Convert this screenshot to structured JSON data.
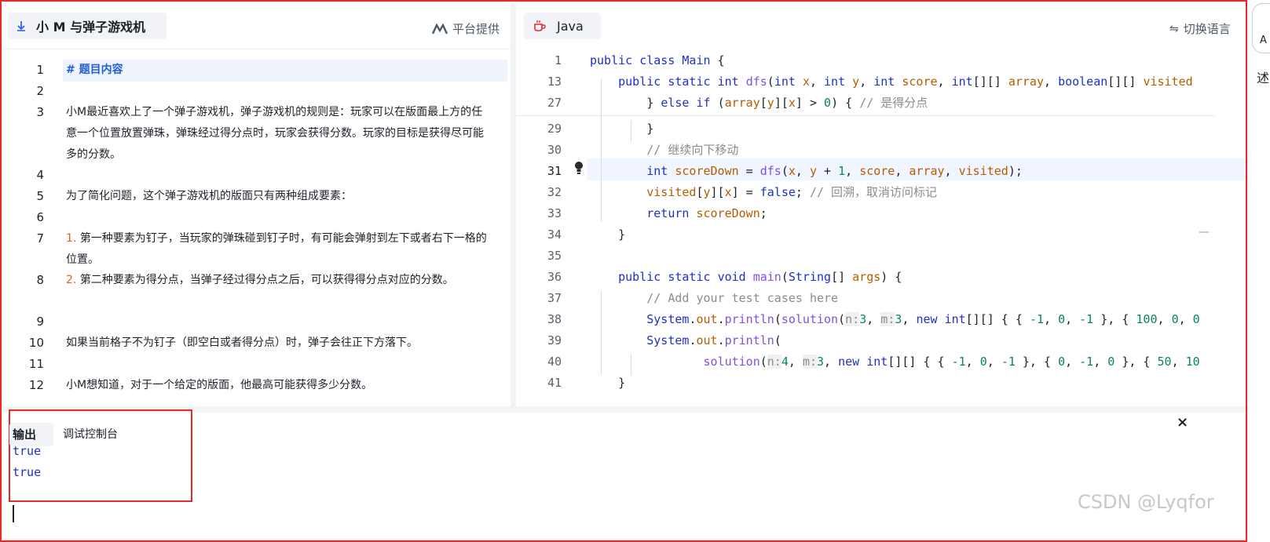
{
  "left": {
    "problem_title": "小 M 与弹子游戏机",
    "provider_label": "平台提供",
    "lines": [
      {
        "n": "1",
        "parts": [
          {
            "t": "# 题目内容",
            "c": "heading"
          }
        ]
      },
      {
        "n": "2",
        "parts": []
      },
      {
        "n": "3",
        "parts": [
          {
            "t": "小M最近喜欢上了一个弹子游戏机，弹子游戏机的规则是：玩家可以在版面最上方的任意一个位置放置弹珠，弹珠经过得分点时，玩家会获得分数。玩家的目标是获得尽可能多的分数。",
            "c": ""
          }
        ]
      },
      {
        "n": "4",
        "parts": []
      },
      {
        "n": "5",
        "parts": [
          {
            "t": "为了简化问题，这个弹子游戏机的版面只有两种组成要素：",
            "c": ""
          }
        ]
      },
      {
        "n": "6",
        "parts": []
      },
      {
        "n": "7",
        "parts": [
          {
            "t": "1. ",
            "c": "num"
          },
          {
            "t": "第一种要素为钉子，当玩家的弹珠碰到钉子时，有可能会弹射到左下或者右下一格的位置。",
            "c": ""
          }
        ]
      },
      {
        "n": "8",
        "parts": [
          {
            "t": "2. ",
            "c": "num"
          },
          {
            "t": "第二种要素为得分点，当弹子经过得分点之后，可以获得得分点对应的分数。",
            "c": ""
          }
        ]
      },
      {
        "n": "9",
        "parts": []
      },
      {
        "n": "10",
        "parts": [
          {
            "t": "如果当前格子不为钉子（即空白或者得分点）时，弹子会往正下方落下。",
            "c": ""
          }
        ]
      },
      {
        "n": "11",
        "parts": []
      },
      {
        "n": "12",
        "parts": [
          {
            "t": "小M想知道，对于一个给定的版面，他最高可能获得多少分数。",
            "c": ""
          }
        ]
      }
    ]
  },
  "right": {
    "language": "Java",
    "switch_label": "切换语言",
    "active_line": "31",
    "code_lines": [
      {
        "n": "1",
        "tokens": [
          [
            "public ",
            "kw"
          ],
          [
            "class ",
            "kw"
          ],
          [
            "Main",
            "cls"
          ],
          [
            " {",
            ""
          ]
        ]
      },
      {
        "n": "13",
        "tokens": [
          [
            "    public ",
            "kw"
          ],
          [
            "static ",
            "kw"
          ],
          [
            "int ",
            "ty"
          ],
          [
            "dfs",
            "fn"
          ],
          [
            "(",
            ""
          ],
          [
            "int ",
            "ty"
          ],
          [
            "x",
            "va"
          ],
          [
            ", ",
            ""
          ],
          [
            "int ",
            "ty"
          ],
          [
            "y",
            "va"
          ],
          [
            ", ",
            ""
          ],
          [
            "int ",
            "ty"
          ],
          [
            "score",
            "va"
          ],
          [
            ", ",
            ""
          ],
          [
            "int",
            "ty"
          ],
          [
            "[][] ",
            ""
          ],
          [
            "array",
            "va"
          ],
          [
            ", ",
            ""
          ],
          [
            "boolean",
            "ty"
          ],
          [
            "[][] ",
            ""
          ],
          [
            "visited",
            "va"
          ]
        ]
      },
      {
        "n": "27",
        "tokens": [
          [
            "        } ",
            ""
          ],
          [
            "else ",
            "kw"
          ],
          [
            "if ",
            "kw"
          ],
          [
            "(",
            ""
          ],
          [
            "array",
            "va"
          ],
          [
            "[",
            ""
          ],
          [
            "y",
            "va"
          ],
          [
            "][",
            ""
          ],
          [
            "x",
            "va"
          ],
          [
            "] > ",
            ""
          ],
          [
            "0",
            "num2"
          ],
          [
            ") { ",
            ""
          ],
          [
            "// 是得分点",
            "cm"
          ]
        ]
      },
      {
        "n": "29",
        "tokens": [
          [
            "        }",
            ""
          ]
        ]
      },
      {
        "n": "30",
        "tokens": [
          [
            "        ",
            ""
          ],
          [
            "// 继续向下移动",
            "cm"
          ]
        ]
      },
      {
        "n": "31",
        "tokens": [
          [
            "        ",
            ""
          ],
          [
            "int ",
            "ty"
          ],
          [
            "scoreDown",
            "va"
          ],
          [
            " = ",
            ""
          ],
          [
            "dfs",
            "fn"
          ],
          [
            "(",
            ""
          ],
          [
            "x",
            "va"
          ],
          [
            ", ",
            ""
          ],
          [
            "y",
            "va"
          ],
          [
            " + ",
            ""
          ],
          [
            "1",
            "num2"
          ],
          [
            ", ",
            ""
          ],
          [
            "score",
            "va"
          ],
          [
            ", ",
            ""
          ],
          [
            "array",
            "va"
          ],
          [
            ", ",
            ""
          ],
          [
            "visited",
            "va"
          ],
          [
            ");",
            ""
          ]
        ]
      },
      {
        "n": "32",
        "tokens": [
          [
            "        ",
            ""
          ],
          [
            "visited",
            "va"
          ],
          [
            "[",
            ""
          ],
          [
            "y",
            "va"
          ],
          [
            "][",
            ""
          ],
          [
            "x",
            "va"
          ],
          [
            "] = ",
            ""
          ],
          [
            "false",
            "kw"
          ],
          [
            "; ",
            ""
          ],
          [
            "// 回溯，取消访问标记",
            "cm"
          ]
        ]
      },
      {
        "n": "33",
        "tokens": [
          [
            "        ",
            ""
          ],
          [
            "return ",
            "kw"
          ],
          [
            "scoreDown",
            "va"
          ],
          [
            ";",
            ""
          ]
        ]
      },
      {
        "n": "34",
        "tokens": [
          [
            "    }",
            ""
          ]
        ]
      },
      {
        "n": "35",
        "tokens": []
      },
      {
        "n": "36",
        "tokens": [
          [
            "    public ",
            "kw"
          ],
          [
            "static ",
            "kw"
          ],
          [
            "void ",
            "ty"
          ],
          [
            "main",
            "fn"
          ],
          [
            "(",
            ""
          ],
          [
            "String",
            "cls"
          ],
          [
            "[] ",
            ""
          ],
          [
            "args",
            "va"
          ],
          [
            ") {",
            ""
          ]
        ]
      },
      {
        "n": "37",
        "tokens": [
          [
            "        ",
            ""
          ],
          [
            "// Add your test cases here",
            "cm"
          ]
        ]
      },
      {
        "n": "38",
        "tokens": [
          [
            "        ",
            ""
          ],
          [
            "System",
            "cls"
          ],
          [
            ".",
            ""
          ],
          [
            "out",
            "va"
          ],
          [
            ".",
            ""
          ],
          [
            "println",
            "fn"
          ],
          [
            "(",
            ""
          ],
          [
            "solution",
            "fn"
          ],
          [
            "(",
            ""
          ],
          [
            "n:",
            "hint"
          ],
          [
            "3",
            "num2"
          ],
          [
            ", ",
            ""
          ],
          [
            "m:",
            "hint"
          ],
          [
            "3",
            "num2"
          ],
          [
            ", ",
            ""
          ],
          [
            "new ",
            "kw"
          ],
          [
            "int",
            "ty"
          ],
          [
            "[][] { { ",
            ""
          ],
          [
            "-1",
            "num2"
          ],
          [
            ", ",
            ""
          ],
          [
            "0",
            "num2"
          ],
          [
            ", ",
            ""
          ],
          [
            "-1",
            "num2"
          ],
          [
            " }, { ",
            ""
          ],
          [
            "100",
            "num2"
          ],
          [
            ", ",
            ""
          ],
          [
            "0",
            "num2"
          ],
          [
            ", ",
            ""
          ],
          [
            "0",
            "num2"
          ]
        ]
      },
      {
        "n": "39",
        "tokens": [
          [
            "        ",
            ""
          ],
          [
            "System",
            "cls"
          ],
          [
            ".",
            ""
          ],
          [
            "out",
            "va"
          ],
          [
            ".",
            ""
          ],
          [
            "println",
            "fn"
          ],
          [
            "(",
            ""
          ]
        ]
      },
      {
        "n": "40",
        "tokens": [
          [
            "                ",
            ""
          ],
          [
            "solution",
            "fn"
          ],
          [
            "(",
            ""
          ],
          [
            "n:",
            "hint"
          ],
          [
            "4",
            "num2"
          ],
          [
            ", ",
            ""
          ],
          [
            "m:",
            "hint"
          ],
          [
            "3",
            "num2"
          ],
          [
            ", ",
            ""
          ],
          [
            "new ",
            "kw"
          ],
          [
            "int",
            "ty"
          ],
          [
            "[][] { { ",
            ""
          ],
          [
            "-1",
            "num2"
          ],
          [
            ", ",
            ""
          ],
          [
            "0",
            "num2"
          ],
          [
            ", ",
            ""
          ],
          [
            "-1",
            "num2"
          ],
          [
            " }, { ",
            ""
          ],
          [
            "0",
            "num2"
          ],
          [
            ", ",
            ""
          ],
          [
            "-1",
            "num2"
          ],
          [
            ", ",
            ""
          ],
          [
            "0",
            "num2"
          ],
          [
            " }, { ",
            ""
          ],
          [
            "50",
            "num2"
          ],
          [
            ", ",
            ""
          ],
          [
            "10",
            "num2"
          ]
        ]
      },
      {
        "n": "41",
        "tokens": [
          [
            "    }",
            ""
          ]
        ]
      }
    ]
  },
  "bottom": {
    "tab_output": "输出",
    "tab_debug": "调试控制台",
    "output_lines": [
      "true",
      "true"
    ],
    "close_symbol": "×"
  },
  "strip": {
    "letter": "A",
    "char": "述"
  },
  "watermark": "CSDN @Lyqfor",
  "colors": {
    "highlight_border": "#e52a2a",
    "keyword": "#1f2fc8",
    "function": "#8250df",
    "variable": "#b75b00",
    "number": "#098658",
    "comment": "#8c8c8c",
    "list_number": "#e0621f",
    "heading": "#1f5fd6"
  }
}
